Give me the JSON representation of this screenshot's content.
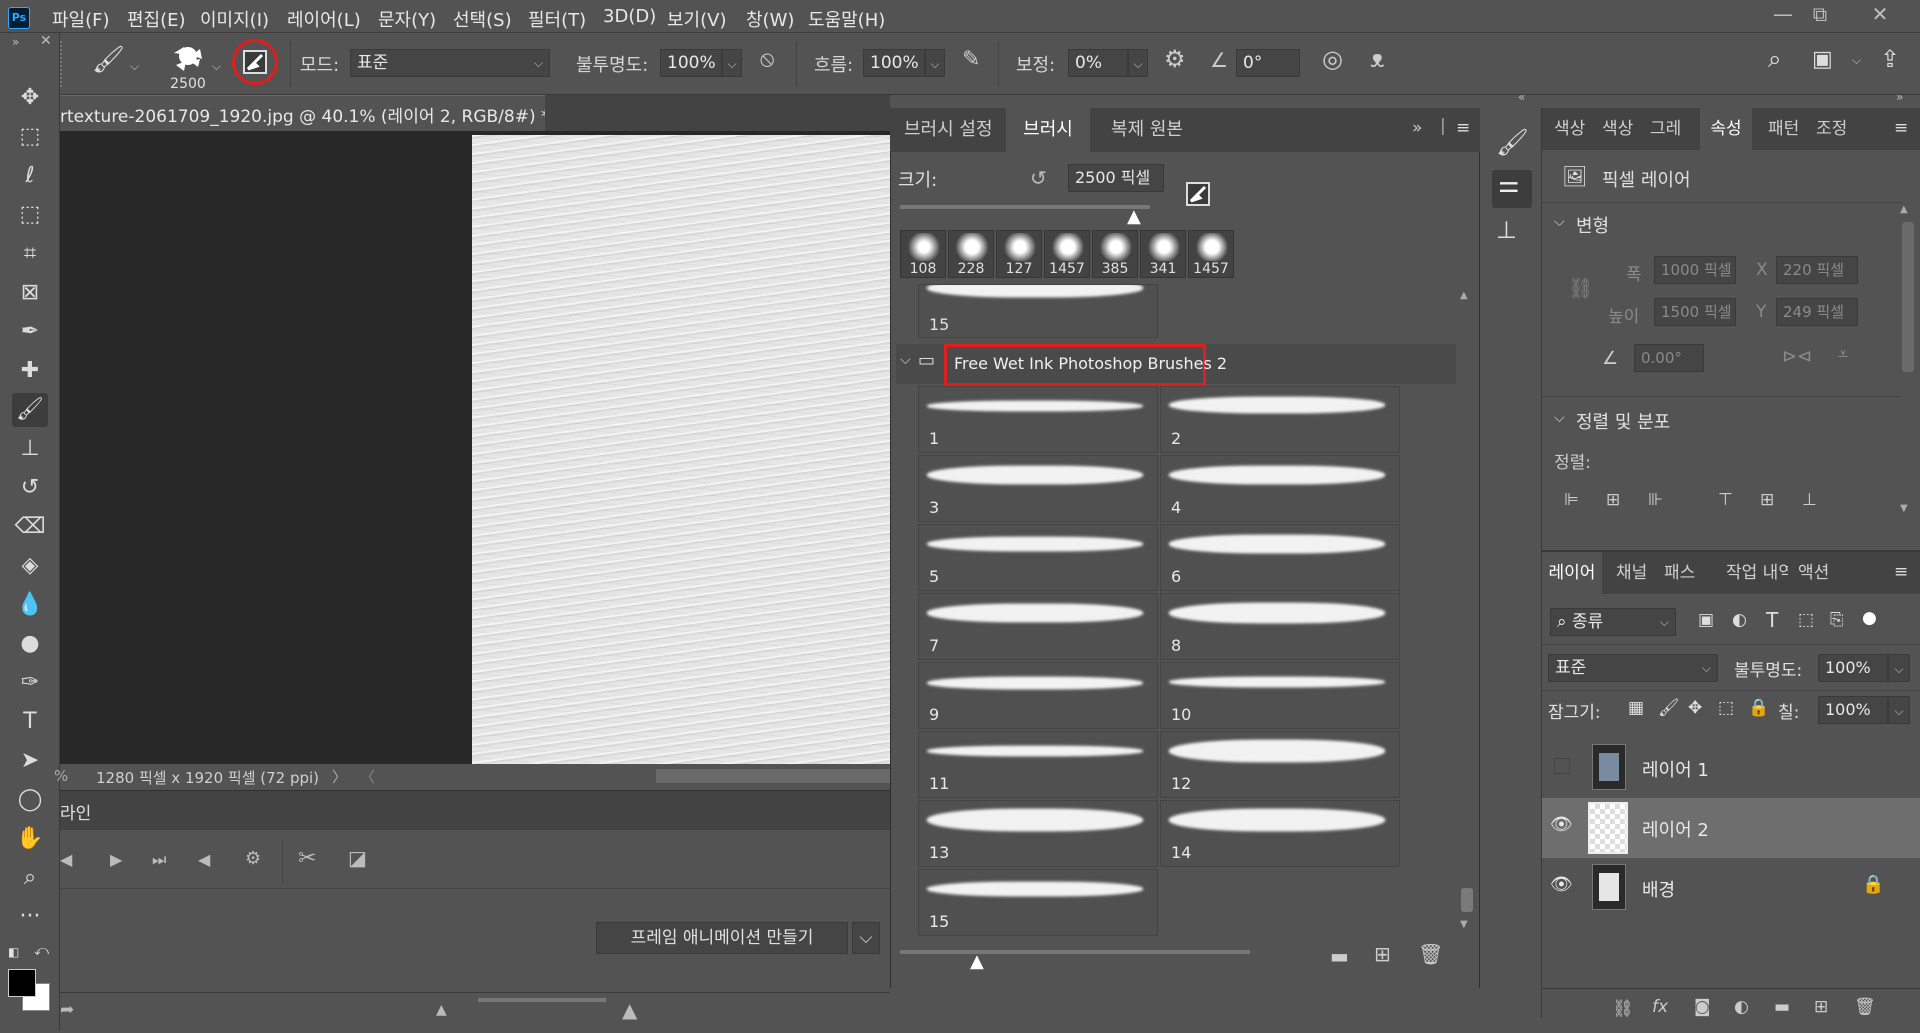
{
  "app": {
    "logo": "Ps"
  },
  "menu": [
    "파일(F)",
    "편집(E)",
    "이미지(I)",
    "레이어(L)",
    "문자(Y)",
    "선택(S)",
    "필터(T)",
    "3D(D)",
    "보기(V)",
    "창(W)",
    "도움말(H)"
  ],
  "window_controls": {
    "minimize": "—",
    "restore": "⧉",
    "close": "✕"
  },
  "options": {
    "brush_size": "2500",
    "mode_label": "모드:",
    "mode_value": "표준",
    "opacity_label": "불투명도:",
    "opacity_value": "100%",
    "flow_label": "흐름:",
    "flow_value": "100%",
    "smoothing_label": "보정:",
    "smoothing_value": "0%",
    "angle_value": "0°"
  },
  "document": {
    "tab_title": "rtexture-2061709_1920.jpg @ 40.1% (레이어 2, RGB/8#) *",
    "tab_close": "×",
    "status": "1280 픽셀 x 1920 픽셀 (72 ppi)",
    "status_zoom": "%"
  },
  "timeline": {
    "tab_label": "라인",
    "create_button": "프레임 애니메이션 만들기"
  },
  "brush_panel": {
    "tabs": [
      "브러시 설정",
      "브러시",
      "복제 원본"
    ],
    "size_label": "크기:",
    "size_value": "2500 픽셀",
    "recent": [
      "108",
      "228",
      "127",
      "1457",
      "385",
      "341",
      "1457"
    ],
    "prev_group_last": "15",
    "group_name": "Free Wet Ink Photoshop Brushes 2",
    "brushes": [
      "1",
      "2",
      "3",
      "4",
      "5",
      "6",
      "7",
      "8",
      "9",
      "10",
      "11",
      "12",
      "13",
      "14",
      "15"
    ]
  },
  "properties": {
    "tabs": [
      "색상",
      "색상",
      "그레",
      "속성",
      "패턴",
      "조정"
    ],
    "kind": "픽셀 레이어",
    "transform_title": "변형",
    "w_label": "폭",
    "w_value": "1000 픽셀",
    "x_label": "X",
    "x_value": "220 픽셀",
    "h_label": "높이",
    "h_value": "1500 픽셀",
    "y_label": "Y",
    "y_value": "249 픽셀",
    "angle_value": "0.00°",
    "align_title": "정렬 및 분포",
    "align_label": "정렬:"
  },
  "layers_panel": {
    "tabs": [
      "레이어",
      "채널",
      "패스",
      "작업 내역",
      "액션"
    ],
    "filter_label": "종류",
    "blend": "표준",
    "opacity_label": "불투명도:",
    "opacity_value": "100%",
    "lock_label": "잠그기:",
    "fill_label": "칠:",
    "fill_value": "100%",
    "layers": [
      {
        "name": "레이어 1",
        "visible": false
      },
      {
        "name": "레이어 2",
        "visible": true,
        "selected": true
      },
      {
        "name": "배경",
        "visible": true,
        "locked": true
      }
    ]
  }
}
